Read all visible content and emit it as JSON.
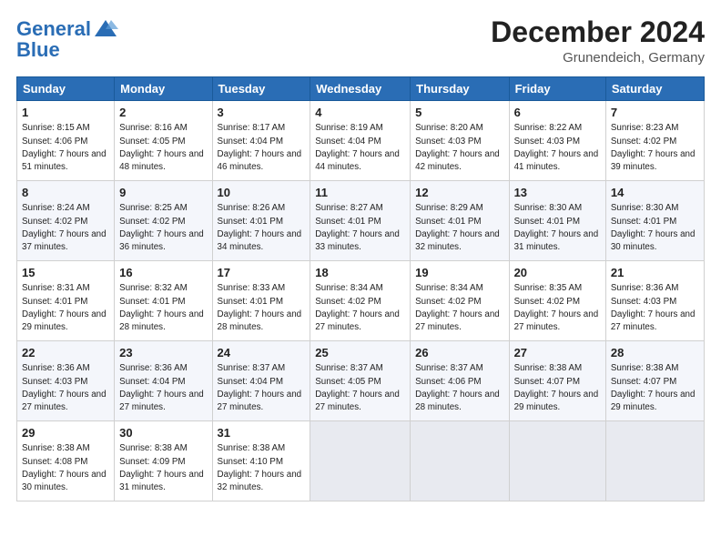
{
  "header": {
    "logo_line1": "General",
    "logo_line2": "Blue",
    "month": "December 2024",
    "location": "Grunendeich, Germany"
  },
  "weekdays": [
    "Sunday",
    "Monday",
    "Tuesday",
    "Wednesday",
    "Thursday",
    "Friday",
    "Saturday"
  ],
  "weeks": [
    [
      {
        "day": "1",
        "sunrise": "8:15 AM",
        "sunset": "4:06 PM",
        "daylight": "7 hours and 51 minutes."
      },
      {
        "day": "2",
        "sunrise": "8:16 AM",
        "sunset": "4:05 PM",
        "daylight": "7 hours and 48 minutes."
      },
      {
        "day": "3",
        "sunrise": "8:17 AM",
        "sunset": "4:04 PM",
        "daylight": "7 hours and 46 minutes."
      },
      {
        "day": "4",
        "sunrise": "8:19 AM",
        "sunset": "4:04 PM",
        "daylight": "7 hours and 44 minutes."
      },
      {
        "day": "5",
        "sunrise": "8:20 AM",
        "sunset": "4:03 PM",
        "daylight": "7 hours and 42 minutes."
      },
      {
        "day": "6",
        "sunrise": "8:22 AM",
        "sunset": "4:03 PM",
        "daylight": "7 hours and 41 minutes."
      },
      {
        "day": "7",
        "sunrise": "8:23 AM",
        "sunset": "4:02 PM",
        "daylight": "7 hours and 39 minutes."
      }
    ],
    [
      {
        "day": "8",
        "sunrise": "8:24 AM",
        "sunset": "4:02 PM",
        "daylight": "7 hours and 37 minutes."
      },
      {
        "day": "9",
        "sunrise": "8:25 AM",
        "sunset": "4:02 PM",
        "daylight": "7 hours and 36 minutes."
      },
      {
        "day": "10",
        "sunrise": "8:26 AM",
        "sunset": "4:01 PM",
        "daylight": "7 hours and 34 minutes."
      },
      {
        "day": "11",
        "sunrise": "8:27 AM",
        "sunset": "4:01 PM",
        "daylight": "7 hours and 33 minutes."
      },
      {
        "day": "12",
        "sunrise": "8:29 AM",
        "sunset": "4:01 PM",
        "daylight": "7 hours and 32 minutes."
      },
      {
        "day": "13",
        "sunrise": "8:30 AM",
        "sunset": "4:01 PM",
        "daylight": "7 hours and 31 minutes."
      },
      {
        "day": "14",
        "sunrise": "8:30 AM",
        "sunset": "4:01 PM",
        "daylight": "7 hours and 30 minutes."
      }
    ],
    [
      {
        "day": "15",
        "sunrise": "8:31 AM",
        "sunset": "4:01 PM",
        "daylight": "7 hours and 29 minutes."
      },
      {
        "day": "16",
        "sunrise": "8:32 AM",
        "sunset": "4:01 PM",
        "daylight": "7 hours and 28 minutes."
      },
      {
        "day": "17",
        "sunrise": "8:33 AM",
        "sunset": "4:01 PM",
        "daylight": "7 hours and 28 minutes."
      },
      {
        "day": "18",
        "sunrise": "8:34 AM",
        "sunset": "4:02 PM",
        "daylight": "7 hours and 27 minutes."
      },
      {
        "day": "19",
        "sunrise": "8:34 AM",
        "sunset": "4:02 PM",
        "daylight": "7 hours and 27 minutes."
      },
      {
        "day": "20",
        "sunrise": "8:35 AM",
        "sunset": "4:02 PM",
        "daylight": "7 hours and 27 minutes."
      },
      {
        "day": "21",
        "sunrise": "8:36 AM",
        "sunset": "4:03 PM",
        "daylight": "7 hours and 27 minutes."
      }
    ],
    [
      {
        "day": "22",
        "sunrise": "8:36 AM",
        "sunset": "4:03 PM",
        "daylight": "7 hours and 27 minutes."
      },
      {
        "day": "23",
        "sunrise": "8:36 AM",
        "sunset": "4:04 PM",
        "daylight": "7 hours and 27 minutes."
      },
      {
        "day": "24",
        "sunrise": "8:37 AM",
        "sunset": "4:04 PM",
        "daylight": "7 hours and 27 minutes."
      },
      {
        "day": "25",
        "sunrise": "8:37 AM",
        "sunset": "4:05 PM",
        "daylight": "7 hours and 27 minutes."
      },
      {
        "day": "26",
        "sunrise": "8:37 AM",
        "sunset": "4:06 PM",
        "daylight": "7 hours and 28 minutes."
      },
      {
        "day": "27",
        "sunrise": "8:38 AM",
        "sunset": "4:07 PM",
        "daylight": "7 hours and 29 minutes."
      },
      {
        "day": "28",
        "sunrise": "8:38 AM",
        "sunset": "4:07 PM",
        "daylight": "7 hours and 29 minutes."
      }
    ],
    [
      {
        "day": "29",
        "sunrise": "8:38 AM",
        "sunset": "4:08 PM",
        "daylight": "7 hours and 30 minutes."
      },
      {
        "day": "30",
        "sunrise": "8:38 AM",
        "sunset": "4:09 PM",
        "daylight": "7 hours and 31 minutes."
      },
      {
        "day": "31",
        "sunrise": "8:38 AM",
        "sunset": "4:10 PM",
        "daylight": "7 hours and 32 minutes."
      },
      {
        "day": "",
        "sunrise": "",
        "sunset": "",
        "daylight": ""
      },
      {
        "day": "",
        "sunrise": "",
        "sunset": "",
        "daylight": ""
      },
      {
        "day": "",
        "sunrise": "",
        "sunset": "",
        "daylight": ""
      },
      {
        "day": "",
        "sunrise": "",
        "sunset": "",
        "daylight": ""
      }
    ]
  ]
}
